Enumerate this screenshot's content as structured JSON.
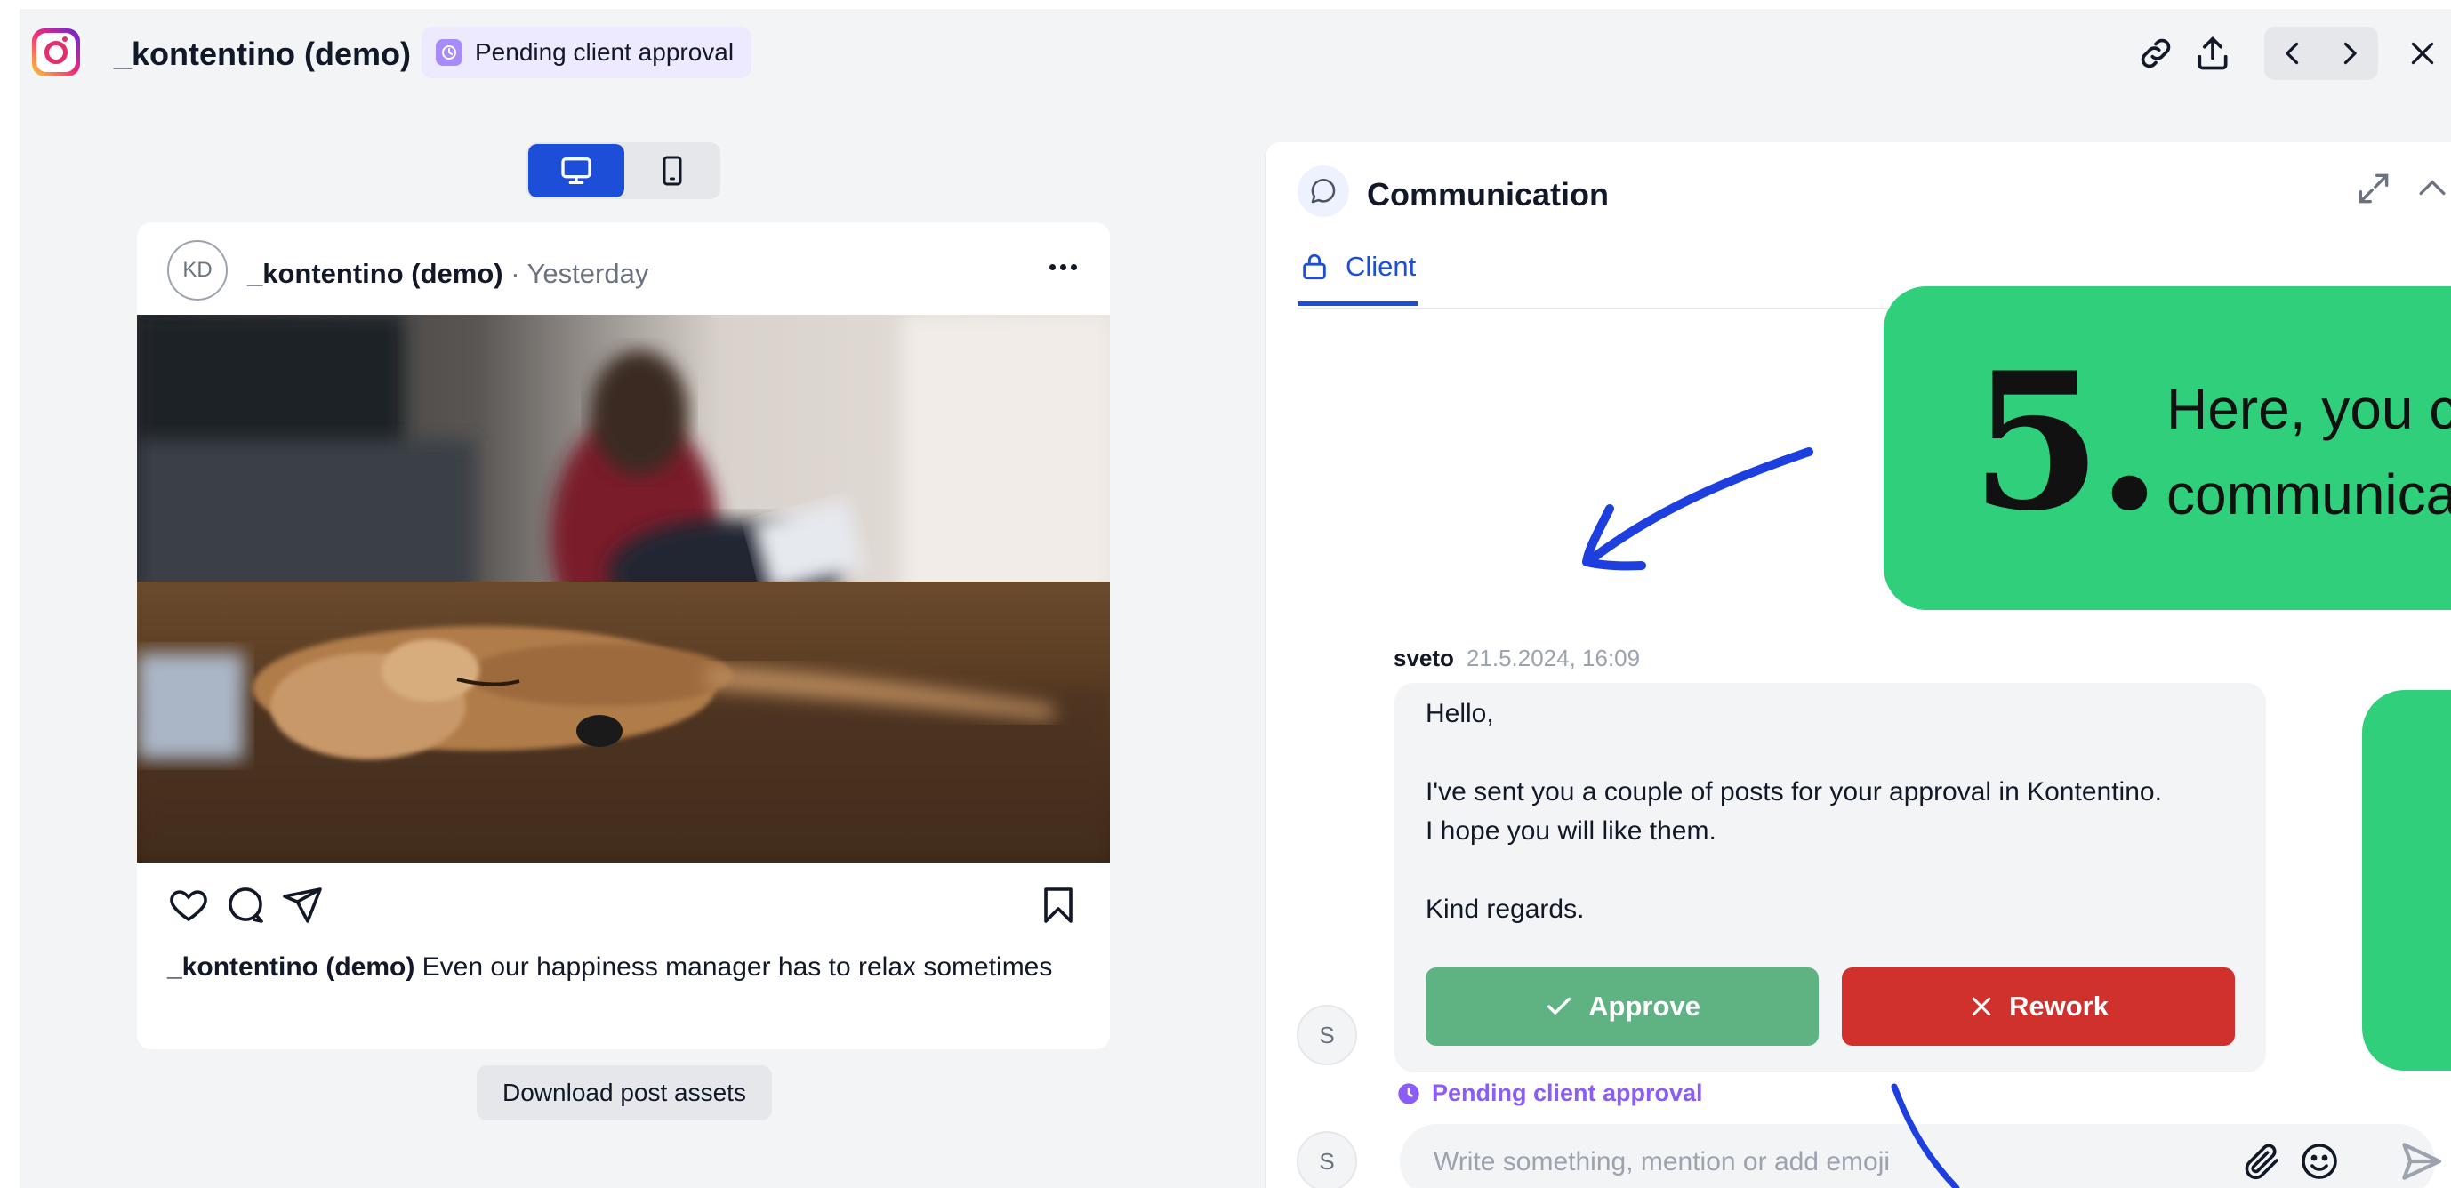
{
  "header": {
    "account_title": "_kontentino (demo)",
    "status": "Pending client approval"
  },
  "post": {
    "avatar_initials": "KD",
    "author": "_kontentino (demo)",
    "time": " · Yesterday",
    "caption_author": "_kontentino (demo)",
    "caption_text": " Even our happiness manager has to relax sometimes",
    "download_label": "Download post assets"
  },
  "communication": {
    "title": "Communication",
    "tab_client": "Client",
    "message": {
      "author": "sveto",
      "timestamp": "21.5.2024, 16:09",
      "lines": [
        "Hello,",
        "I've sent you a couple of posts for your approval in Kontentino.",
        "I hope you will like them.",
        "Kind regards."
      ],
      "approve_label": "Approve",
      "rework_label": "Rework",
      "avatar_initial": "S"
    },
    "status": "Pending client approval",
    "composer": {
      "avatar_initial": "S",
      "placeholder": "Write something, mention or add emoji"
    }
  },
  "tour": {
    "step_number": "5.",
    "text_line1": "Here, you c",
    "text_line2": "communica"
  },
  "colors": {
    "accent_blue": "#1d4ed8",
    "approve_green": "#5fb383",
    "rework_red": "#d0312d",
    "tour_green": "#2fcf7c",
    "status_purple": "#8b5cf6"
  }
}
